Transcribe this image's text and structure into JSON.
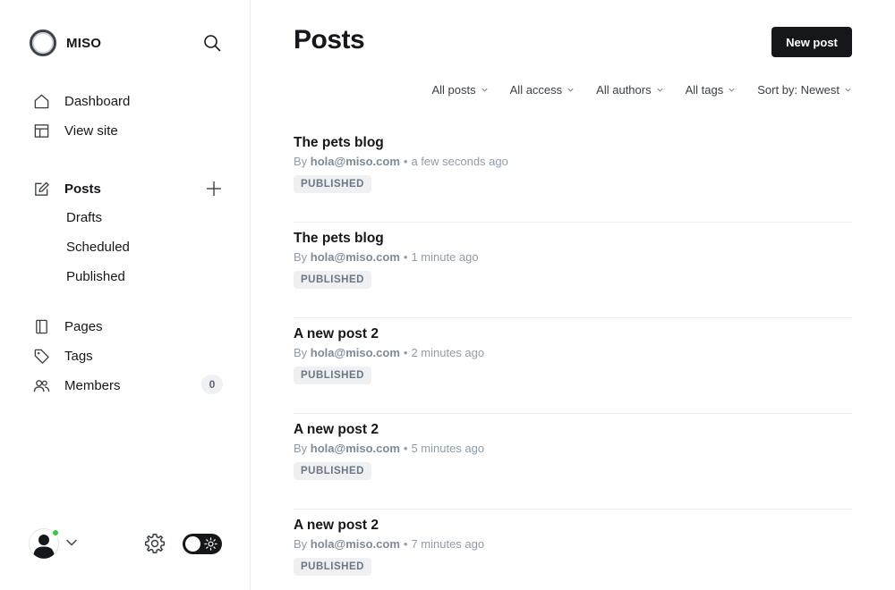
{
  "brand": {
    "name": "MISO"
  },
  "sidebar": {
    "nav_top": [
      {
        "label": "Dashboard",
        "icon": "home-icon"
      },
      {
        "label": "View site",
        "icon": "layout-icon"
      }
    ],
    "posts": {
      "label": "Posts",
      "icon": "edit-icon"
    },
    "post_subitems": [
      "Drafts",
      "Scheduled",
      "Published"
    ],
    "nav_bottom": [
      {
        "label": "Pages",
        "icon": "pages-icon"
      },
      {
        "label": "Tags",
        "icon": "tag-icon"
      },
      {
        "label": "Members",
        "icon": "members-icon",
        "count": "0"
      }
    ]
  },
  "main": {
    "title": "Posts",
    "new_post_label": "New post",
    "filters": [
      "All posts",
      "All access",
      "All authors",
      "All tags",
      "Sort by: Newest"
    ],
    "posts": [
      {
        "title": "The pets blog",
        "by": "By",
        "author": "hola@miso.com",
        "time": "a few seconds ago",
        "status": "PUBLISHED"
      },
      {
        "title": "The pets blog",
        "by": "By",
        "author": "hola@miso.com",
        "time": "1 minute ago",
        "status": "PUBLISHED"
      },
      {
        "title": "A new post 2",
        "by": "By",
        "author": "hola@miso.com",
        "time": "2 minutes ago",
        "status": "PUBLISHED"
      },
      {
        "title": "A new post 2",
        "by": "By",
        "author": "hola@miso.com",
        "time": "5 minutes ago",
        "status": "PUBLISHED"
      },
      {
        "title": "A new post 2",
        "by": "By",
        "author": "hola@miso.com",
        "time": "7 minutes ago",
        "status": "PUBLISHED"
      }
    ]
  },
  "colors": {
    "accent": "#15171a",
    "online": "#30cf43",
    "muted": "#8e9cac"
  }
}
